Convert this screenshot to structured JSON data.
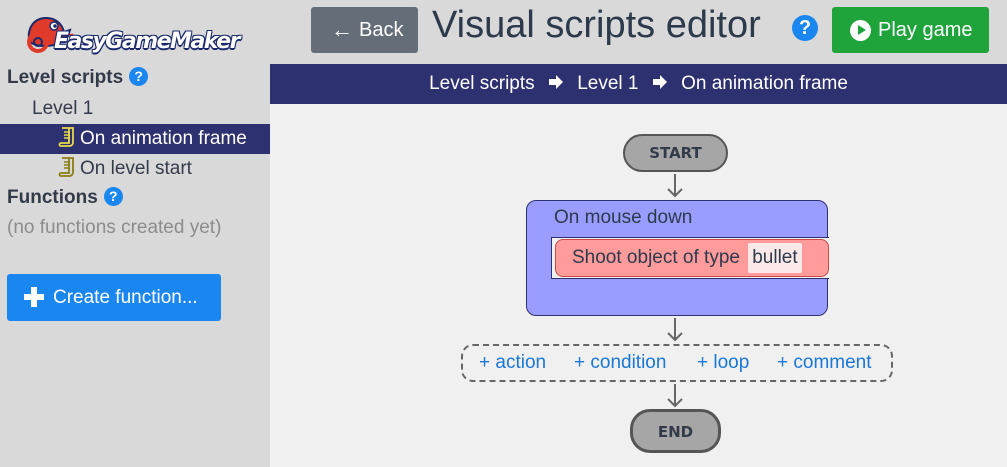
{
  "app": {
    "logo_text": "EasyGameMaker"
  },
  "header": {
    "back_label": "Back",
    "title": "Visual scripts editor",
    "help_glyph": "?",
    "play_label": "Play game"
  },
  "sidebar": {
    "level_scripts_heading": "Level scripts",
    "help_glyph": "?",
    "level_name": "Level 1",
    "scripts": [
      {
        "label": "On animation frame",
        "selected": true
      },
      {
        "label": "On level start",
        "selected": false
      }
    ],
    "functions_heading": "Functions",
    "no_functions_text": "(no functions created yet)",
    "create_function_label": "Create function..."
  },
  "breadcrumb": [
    "Level scripts",
    "Level 1",
    "On animation frame"
  ],
  "canvas": {
    "start_label": "START",
    "end_label": "END",
    "event_label": "On mouse down",
    "action_text": "Shoot object of type",
    "action_param": "bullet",
    "add_links": [
      "+ action",
      "+ condition",
      "+ loop",
      "+ comment"
    ]
  },
  "colors": {
    "sidebar_bg": "#d9d9d9",
    "nav_dark": "#2e3170",
    "primary_blue": "#1a86f0",
    "play_green": "#1fa33b",
    "back_gray": "#646d78",
    "event_block": "#9b9cff",
    "action_block": "#ff9b9b",
    "link_blue": "#1a77d6"
  },
  "icons": [
    "help-icon",
    "back-arrow-icon",
    "play-icon",
    "script-scroll-icon",
    "plus-icon",
    "arrow-right-icon",
    "arrow-down-icon"
  ]
}
